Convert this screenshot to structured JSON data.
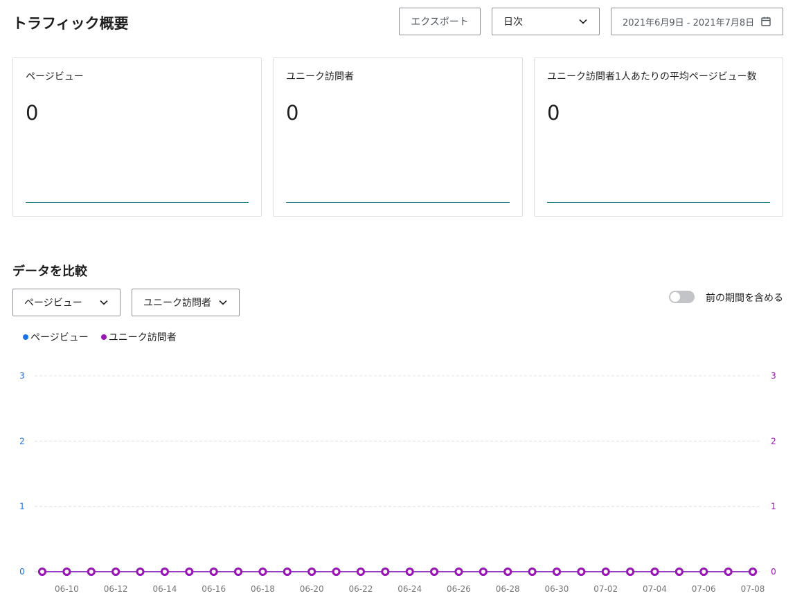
{
  "header": {
    "title": "トラフィック概要",
    "export_label": "エクスポート",
    "interval_value": "日次",
    "date_range": "2021年6月9日 - 2021年7月8日"
  },
  "cards": [
    {
      "label": "ページビュー",
      "value": "0"
    },
    {
      "label": "ユニーク訪問者",
      "value": "0"
    },
    {
      "label": "ユニーク訪問者1人あたりの平均ページビュー数",
      "value": "0"
    }
  ],
  "compare": {
    "title": "データを比較",
    "metric_1": "ページビュー",
    "metric_2": "ユニーク訪問者",
    "toggle_label": "前の期間を含める",
    "toggle_on": false
  },
  "colors": {
    "series_1": "#1a73e8",
    "series_2": "#9c14b4",
    "card_line": "#1a7a8a"
  },
  "chart_data": {
    "type": "line",
    "legend": "top-left",
    "grid": true,
    "x": [
      "06-09",
      "06-10",
      "06-11",
      "06-12",
      "06-13",
      "06-14",
      "06-15",
      "06-16",
      "06-17",
      "06-18",
      "06-19",
      "06-20",
      "06-21",
      "06-22",
      "06-23",
      "06-24",
      "06-25",
      "06-26",
      "06-27",
      "06-28",
      "06-29",
      "06-30",
      "07-01",
      "07-02",
      "07-03",
      "07-04",
      "07-05",
      "07-06",
      "07-07",
      "07-08"
    ],
    "tick_labels": [
      "06-10",
      "06-12",
      "06-14",
      "06-16",
      "06-18",
      "06-20",
      "06-22",
      "06-24",
      "06-26",
      "06-28",
      "06-30",
      "07-02",
      "07-04",
      "07-06",
      "07-08"
    ],
    "ylim": [
      0,
      3
    ],
    "yticks": [
      "0",
      "1",
      "2",
      "3"
    ],
    "series": [
      {
        "name": "ページビュー",
        "axis": "left",
        "values": [
          0,
          0,
          0,
          0,
          0,
          0,
          0,
          0,
          0,
          0,
          0,
          0,
          0,
          0,
          0,
          0,
          0,
          0,
          0,
          0,
          0,
          0,
          0,
          0,
          0,
          0,
          0,
          0,
          0,
          0
        ]
      },
      {
        "name": "ユニーク訪問者",
        "axis": "right",
        "values": [
          0,
          0,
          0,
          0,
          0,
          0,
          0,
          0,
          0,
          0,
          0,
          0,
          0,
          0,
          0,
          0,
          0,
          0,
          0,
          0,
          0,
          0,
          0,
          0,
          0,
          0,
          0,
          0,
          0,
          0
        ]
      }
    ]
  }
}
